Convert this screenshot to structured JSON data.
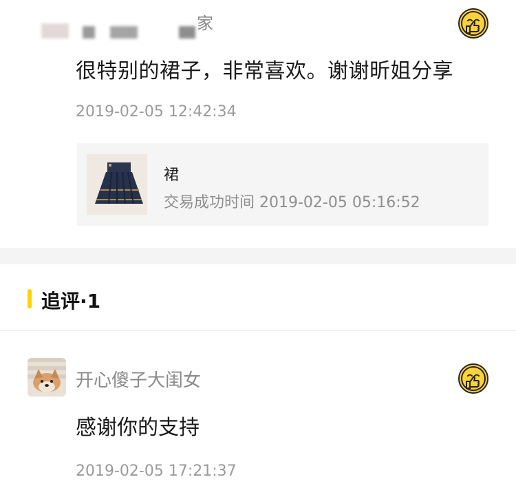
{
  "review": {
    "username_visible": "家",
    "text": "很特别的裙子，非常喜欢。谢谢昕姐分享",
    "time": "2019-02-05 12:42:34",
    "order": {
      "title": "裙",
      "status": "交易成功时间 2019-02-05 05:16:52",
      "thumb_icon": "skirt-thumbnail"
    },
    "emoji_icon": "thumbs-up-face-icon"
  },
  "follow_up": {
    "title": "追评·1",
    "accent_color": "#ffd200"
  },
  "reply": {
    "name": "开心傻子大闺女",
    "text": "感谢你的支持",
    "time": "2019-02-05 17:21:37",
    "avatar_icon": "shiba-dog-avatar",
    "emoji_icon": "thumbs-up-face-icon"
  }
}
